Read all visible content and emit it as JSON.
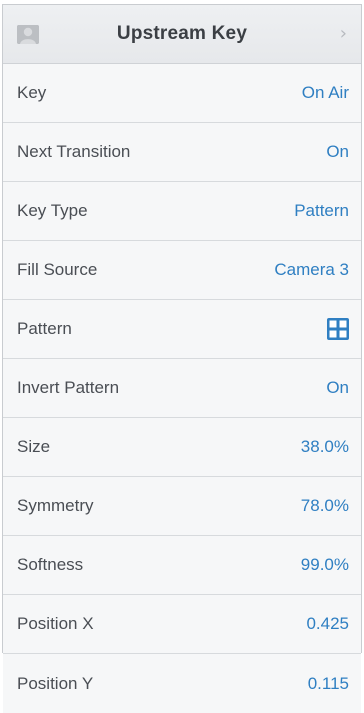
{
  "header": {
    "title": "Upstream Key",
    "avatar_icon": "person-placeholder-icon",
    "chevron_icon": "chevron-right-icon"
  },
  "colors": {
    "value": "#2f7fc2",
    "label": "#4a4e54",
    "pattern_icon": "#2f7fc2"
  },
  "rows": [
    {
      "label": "Key",
      "value": "On Air"
    },
    {
      "label": "Next Transition",
      "value": "On"
    },
    {
      "label": "Key Type",
      "value": "Pattern"
    },
    {
      "label": "Fill Source",
      "value": "Camera 3"
    },
    {
      "label": "Pattern",
      "value_icon": "cross-pattern-icon"
    },
    {
      "label": "Invert Pattern",
      "value": "On"
    },
    {
      "label": "Size",
      "value": "38.0%"
    },
    {
      "label": "Symmetry",
      "value": "78.0%"
    },
    {
      "label": "Softness",
      "value": "99.0%"
    },
    {
      "label": "Position X",
      "value": "0.425"
    },
    {
      "label": "Position Y",
      "value": "0.115"
    }
  ]
}
